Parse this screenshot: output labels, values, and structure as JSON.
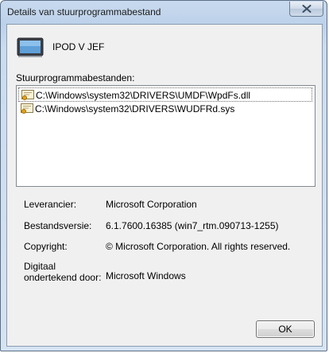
{
  "window": {
    "title": "Details van stuurprogrammabestand"
  },
  "device": {
    "name": "IPOD V JEF",
    "icon": "portable-device-icon"
  },
  "files": {
    "label": "Stuurprogrammabestanden:",
    "items": [
      {
        "path": "C:\\Windows\\system32\\DRIVERS\\UMDF\\WpdFs.dll",
        "icon": "certificate-file-icon",
        "selected": true
      },
      {
        "path": "C:\\Windows\\system32\\DRIVERS\\WUDFRd.sys",
        "icon": "certificate-file-icon",
        "selected": false
      }
    ]
  },
  "details": {
    "provider_label": "Leverancier:",
    "provider_value": "Microsoft Corporation",
    "version_label": "Bestandsversie:",
    "version_value": "6.1.7600.16385 (win7_rtm.090713-1255)",
    "copyright_label": "Copyright:",
    "copyright_value": "© Microsoft Corporation. All rights reserved.",
    "signer_label_line1": "Digitaal",
    "signer_label_line2": "ondertekend door:",
    "signer_value": "Microsoft Windows"
  },
  "buttons": {
    "ok_label": "OK"
  },
  "colors": {
    "frame": "#bcd1ea",
    "close_glyph": "#3d4e63",
    "client_bg": "#f0f0f0"
  }
}
